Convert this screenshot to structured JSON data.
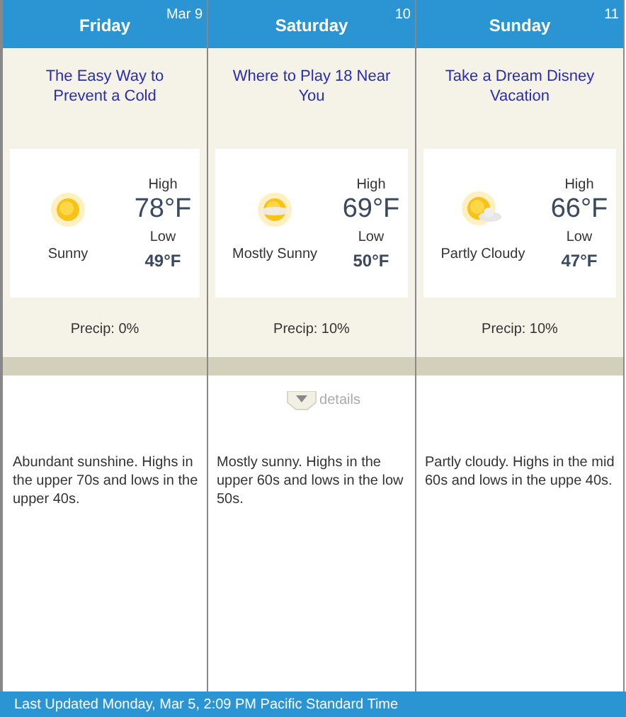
{
  "days": [
    {
      "day": "Friday",
      "date": "Mar 9",
      "headline": "The Easy Way to Prevent a Cold",
      "kind": "sunny",
      "condition": "Sunny",
      "high_label": "High",
      "high": "78°F",
      "low_label": "Low",
      "low": "49°F",
      "precip": "Precip: 0%",
      "description": "Abundant sunshine. Highs in the upper 70s and lows in the upper 40s."
    },
    {
      "day": "Saturday",
      "date": "10",
      "headline": "Where to Play 18 Near You",
      "kind": "mostly_sunny",
      "condition": "Mostly Sunny",
      "high_label": "High",
      "high": "69°F",
      "low_label": "Low",
      "low": "50°F",
      "precip": "Precip: 10%",
      "details": "details",
      "description": "Mostly sunny. Highs in the upper 60s and lows in the low 50s."
    },
    {
      "day": "Sunday",
      "date": "11",
      "headline": "Take a Dream Disney Vacation",
      "kind": "partly_cloudy",
      "condition": "Partly Cloudy",
      "high_label": "High",
      "high": "66°F",
      "low_label": "Low",
      "low": "47°F",
      "precip": "Precip: 10%",
      "description": "Partly cloudy. Highs in the mid 60s and lows in the uppe 40s."
    }
  ],
  "status_bar": "Last Updated Monday, Mar 5, 2:09 PM Pacific Standard Time"
}
